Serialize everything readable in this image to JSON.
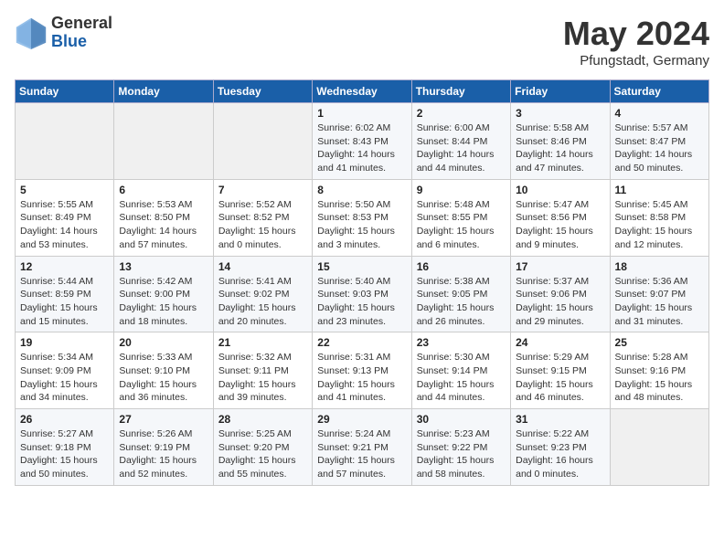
{
  "header": {
    "logo": {
      "general": "General",
      "blue": "Blue"
    },
    "title": "May 2024",
    "location": "Pfungstadt, Germany"
  },
  "calendar": {
    "weekdays": [
      "Sunday",
      "Monday",
      "Tuesday",
      "Wednesday",
      "Thursday",
      "Friday",
      "Saturday"
    ],
    "weeks": [
      [
        {
          "day": "",
          "sunrise": "",
          "sunset": "",
          "daylight": ""
        },
        {
          "day": "",
          "sunrise": "",
          "sunset": "",
          "daylight": ""
        },
        {
          "day": "",
          "sunrise": "",
          "sunset": "",
          "daylight": ""
        },
        {
          "day": "1",
          "sunrise": "Sunrise: 6:02 AM",
          "sunset": "Sunset: 8:43 PM",
          "daylight": "Daylight: 14 hours and 41 minutes."
        },
        {
          "day": "2",
          "sunrise": "Sunrise: 6:00 AM",
          "sunset": "Sunset: 8:44 PM",
          "daylight": "Daylight: 14 hours and 44 minutes."
        },
        {
          "day": "3",
          "sunrise": "Sunrise: 5:58 AM",
          "sunset": "Sunset: 8:46 PM",
          "daylight": "Daylight: 14 hours and 47 minutes."
        },
        {
          "day": "4",
          "sunrise": "Sunrise: 5:57 AM",
          "sunset": "Sunset: 8:47 PM",
          "daylight": "Daylight: 14 hours and 50 minutes."
        }
      ],
      [
        {
          "day": "5",
          "sunrise": "Sunrise: 5:55 AM",
          "sunset": "Sunset: 8:49 PM",
          "daylight": "Daylight: 14 hours and 53 minutes."
        },
        {
          "day": "6",
          "sunrise": "Sunrise: 5:53 AM",
          "sunset": "Sunset: 8:50 PM",
          "daylight": "Daylight: 14 hours and 57 minutes."
        },
        {
          "day": "7",
          "sunrise": "Sunrise: 5:52 AM",
          "sunset": "Sunset: 8:52 PM",
          "daylight": "Daylight: 15 hours and 0 minutes."
        },
        {
          "day": "8",
          "sunrise": "Sunrise: 5:50 AM",
          "sunset": "Sunset: 8:53 PM",
          "daylight": "Daylight: 15 hours and 3 minutes."
        },
        {
          "day": "9",
          "sunrise": "Sunrise: 5:48 AM",
          "sunset": "Sunset: 8:55 PM",
          "daylight": "Daylight: 15 hours and 6 minutes."
        },
        {
          "day": "10",
          "sunrise": "Sunrise: 5:47 AM",
          "sunset": "Sunset: 8:56 PM",
          "daylight": "Daylight: 15 hours and 9 minutes."
        },
        {
          "day": "11",
          "sunrise": "Sunrise: 5:45 AM",
          "sunset": "Sunset: 8:58 PM",
          "daylight": "Daylight: 15 hours and 12 minutes."
        }
      ],
      [
        {
          "day": "12",
          "sunrise": "Sunrise: 5:44 AM",
          "sunset": "Sunset: 8:59 PM",
          "daylight": "Daylight: 15 hours and 15 minutes."
        },
        {
          "day": "13",
          "sunrise": "Sunrise: 5:42 AM",
          "sunset": "Sunset: 9:00 PM",
          "daylight": "Daylight: 15 hours and 18 minutes."
        },
        {
          "day": "14",
          "sunrise": "Sunrise: 5:41 AM",
          "sunset": "Sunset: 9:02 PM",
          "daylight": "Daylight: 15 hours and 20 minutes."
        },
        {
          "day": "15",
          "sunrise": "Sunrise: 5:40 AM",
          "sunset": "Sunset: 9:03 PM",
          "daylight": "Daylight: 15 hours and 23 minutes."
        },
        {
          "day": "16",
          "sunrise": "Sunrise: 5:38 AM",
          "sunset": "Sunset: 9:05 PM",
          "daylight": "Daylight: 15 hours and 26 minutes."
        },
        {
          "day": "17",
          "sunrise": "Sunrise: 5:37 AM",
          "sunset": "Sunset: 9:06 PM",
          "daylight": "Daylight: 15 hours and 29 minutes."
        },
        {
          "day": "18",
          "sunrise": "Sunrise: 5:36 AM",
          "sunset": "Sunset: 9:07 PM",
          "daylight": "Daylight: 15 hours and 31 minutes."
        }
      ],
      [
        {
          "day": "19",
          "sunrise": "Sunrise: 5:34 AM",
          "sunset": "Sunset: 9:09 PM",
          "daylight": "Daylight: 15 hours and 34 minutes."
        },
        {
          "day": "20",
          "sunrise": "Sunrise: 5:33 AM",
          "sunset": "Sunset: 9:10 PM",
          "daylight": "Daylight: 15 hours and 36 minutes."
        },
        {
          "day": "21",
          "sunrise": "Sunrise: 5:32 AM",
          "sunset": "Sunset: 9:11 PM",
          "daylight": "Daylight: 15 hours and 39 minutes."
        },
        {
          "day": "22",
          "sunrise": "Sunrise: 5:31 AM",
          "sunset": "Sunset: 9:13 PM",
          "daylight": "Daylight: 15 hours and 41 minutes."
        },
        {
          "day": "23",
          "sunrise": "Sunrise: 5:30 AM",
          "sunset": "Sunset: 9:14 PM",
          "daylight": "Daylight: 15 hours and 44 minutes."
        },
        {
          "day": "24",
          "sunrise": "Sunrise: 5:29 AM",
          "sunset": "Sunset: 9:15 PM",
          "daylight": "Daylight: 15 hours and 46 minutes."
        },
        {
          "day": "25",
          "sunrise": "Sunrise: 5:28 AM",
          "sunset": "Sunset: 9:16 PM",
          "daylight": "Daylight: 15 hours and 48 minutes."
        }
      ],
      [
        {
          "day": "26",
          "sunrise": "Sunrise: 5:27 AM",
          "sunset": "Sunset: 9:18 PM",
          "daylight": "Daylight: 15 hours and 50 minutes."
        },
        {
          "day": "27",
          "sunrise": "Sunrise: 5:26 AM",
          "sunset": "Sunset: 9:19 PM",
          "daylight": "Daylight: 15 hours and 52 minutes."
        },
        {
          "day": "28",
          "sunrise": "Sunrise: 5:25 AM",
          "sunset": "Sunset: 9:20 PM",
          "daylight": "Daylight: 15 hours and 55 minutes."
        },
        {
          "day": "29",
          "sunrise": "Sunrise: 5:24 AM",
          "sunset": "Sunset: 9:21 PM",
          "daylight": "Daylight: 15 hours and 57 minutes."
        },
        {
          "day": "30",
          "sunrise": "Sunrise: 5:23 AM",
          "sunset": "Sunset: 9:22 PM",
          "daylight": "Daylight: 15 hours and 58 minutes."
        },
        {
          "day": "31",
          "sunrise": "Sunrise: 5:22 AM",
          "sunset": "Sunset: 9:23 PM",
          "daylight": "Daylight: 16 hours and 0 minutes."
        },
        {
          "day": "",
          "sunrise": "",
          "sunset": "",
          "daylight": ""
        }
      ]
    ]
  }
}
